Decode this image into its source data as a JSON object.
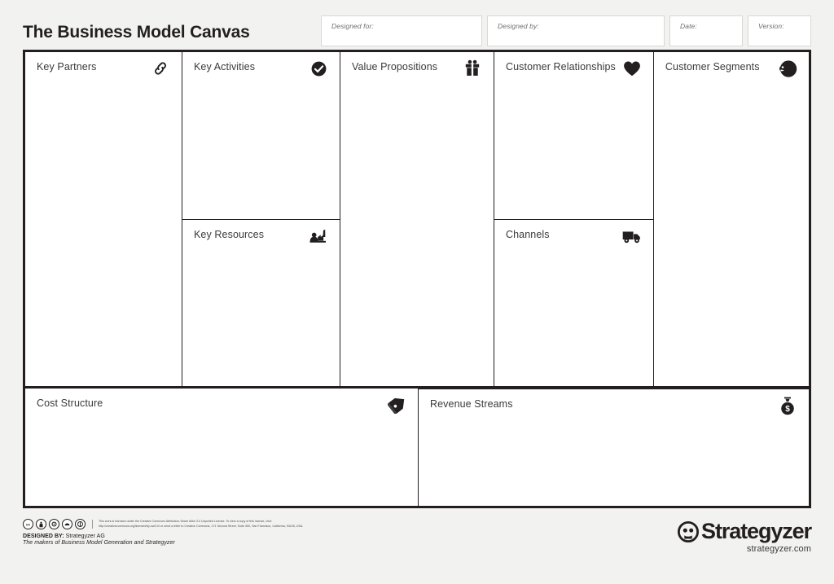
{
  "header": {
    "title": "The Business Model Canvas",
    "fields": [
      {
        "name": "designed-for",
        "label": "Designed for:",
        "value": ""
      },
      {
        "name": "designed-by",
        "label": "Designed by:",
        "value": ""
      },
      {
        "name": "date",
        "label": "Date:",
        "value": ""
      },
      {
        "name": "version",
        "label": "Version:",
        "value": ""
      }
    ]
  },
  "canvas": {
    "blocks": {
      "key_partners": {
        "title": "Key Partners",
        "icon": "chain-link-icon",
        "content": ""
      },
      "key_activities": {
        "title": "Key Activities",
        "icon": "check-circle-icon",
        "content": ""
      },
      "key_resources": {
        "title": "Key Resources",
        "icon": "factory-icon",
        "content": ""
      },
      "value_propositions": {
        "title": "Value Propositions",
        "icon": "gift-box-icon",
        "content": ""
      },
      "customer_relationships": {
        "title": "Customer Relationships",
        "icon": "heart-icon",
        "content": ""
      },
      "channels": {
        "title": "Channels",
        "icon": "delivery-truck-icon",
        "content": ""
      },
      "customer_segments": {
        "title": "Customer Segments",
        "icon": "person-profile-icon",
        "content": ""
      },
      "cost_structure": {
        "title": "Cost Structure",
        "icon": "price-tags-icon",
        "content": ""
      },
      "revenue_streams": {
        "title": "Revenue Streams",
        "icon": "money-bag-icon",
        "content": ""
      }
    }
  },
  "footer": {
    "cc_badges": [
      "cc-icon",
      "by-icon",
      "sa-icon",
      "nc-icon",
      "zero-icon"
    ],
    "license_line_1": "This work is licensed under the Creative Commons Attribution-Share Alike 3.0 Unported License. To view a copy of this license, visit:",
    "license_line_2": "http://creativecommons.org/licenses/by-sa/3.0/ or send a letter to Creative Commons, 171 Second Street, Suite 300, San Francisco, California, 94105, USA.",
    "designed_by_label": "DESIGNED BY:",
    "designed_by_value": "Strategyzer AG",
    "makers_line": "The makers of Business Model Generation and Strategyzer",
    "brand_name": "Strategyzer",
    "brand_url": "strategyzer.com"
  },
  "colors": {
    "page_background": "#f2f2f0",
    "canvas_background": "#ffffff",
    "border": "#231f20",
    "text": "#231f20",
    "muted_text": "#6f6f6f"
  }
}
